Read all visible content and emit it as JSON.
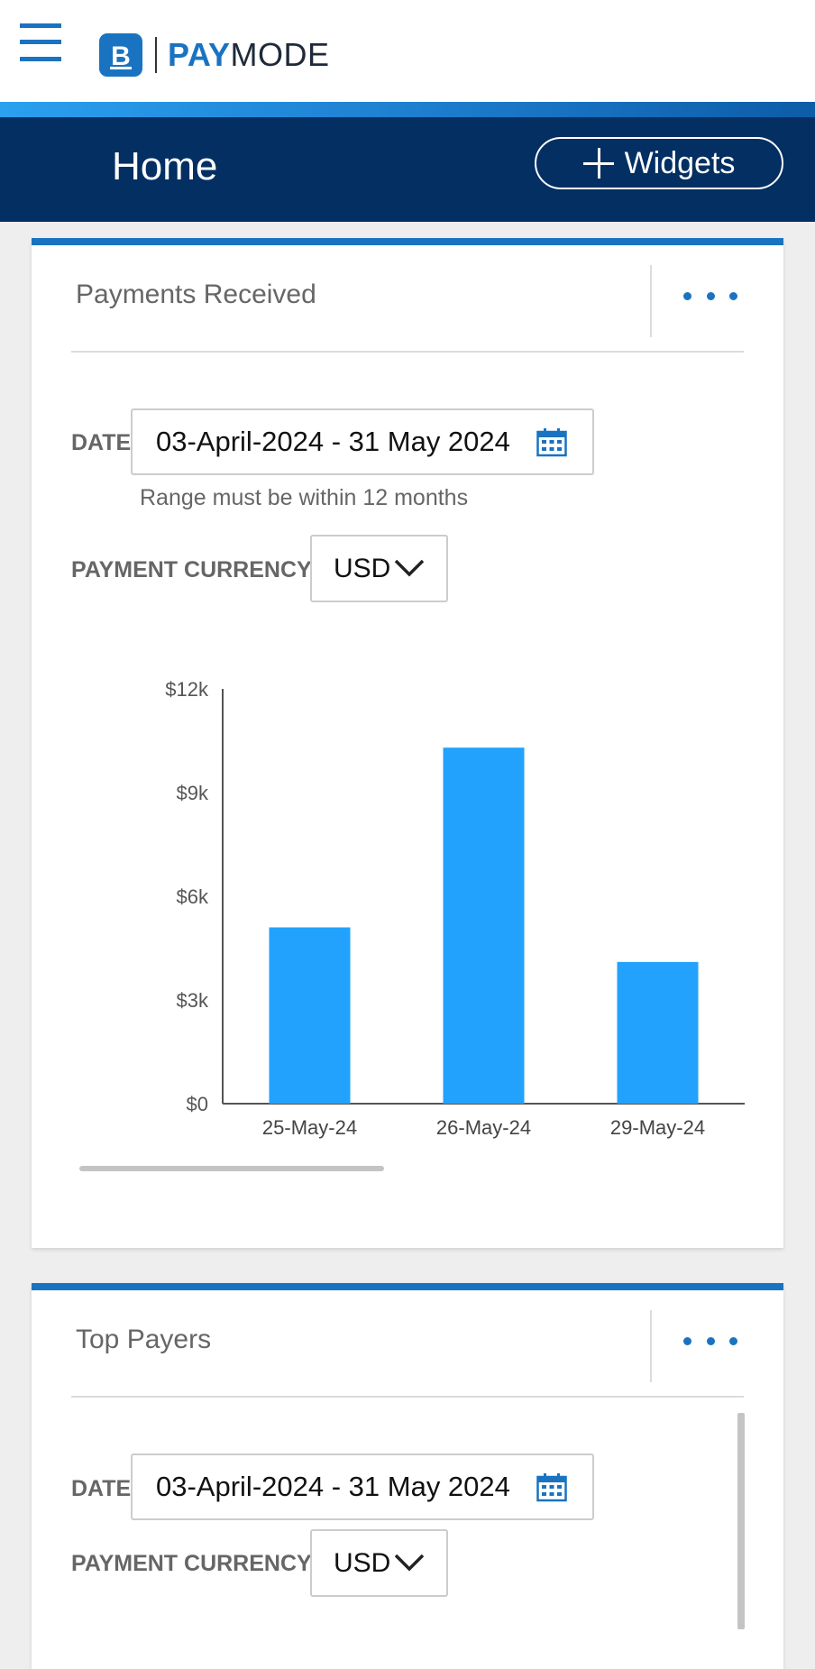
{
  "app": {
    "logo_letter": "B",
    "logo_pay": "PAY",
    "logo_mode": "MODE"
  },
  "header": {
    "title": "Home",
    "widgets_label": "Widgets"
  },
  "colors": {
    "brand_blue": "#1a73c1",
    "header_navy": "#032f62",
    "bar_blue": "#22a2fc"
  },
  "payments_received": {
    "title": "Payments Received",
    "date_label": "DATE",
    "date_value": "03-April-2024 - 31 May 2024",
    "date_hint": "Range must be within 12 months",
    "currency_label": "PAYMENT CURRENCY",
    "currency_value": "USD"
  },
  "top_payers": {
    "title": "Top Payers",
    "date_label": "DATE",
    "date_value": "03-April-2024 - 31 May 2024",
    "currency_label": "PAYMENT CURRENCY",
    "currency_value": "USD"
  },
  "icons": {
    "menu": "hamburger-menu-icon",
    "add": "plus-icon",
    "more": "more-horizontal-icon",
    "calendar": "calendar-icon",
    "dropdown": "chevron-down-icon"
  },
  "chart_data": {
    "type": "bar",
    "categories": [
      "25-May-24",
      "26-May-24",
      "29-May-24"
    ],
    "values": [
      5100,
      10300,
      4100
    ],
    "ylim": [
      0,
      12000
    ],
    "yticks": [
      0,
      3000,
      6000,
      9000,
      12000
    ],
    "ytick_labels": [
      "$0",
      "$3k",
      "$6k",
      "$9k",
      "$12k"
    ],
    "grid": false,
    "legend": false
  }
}
